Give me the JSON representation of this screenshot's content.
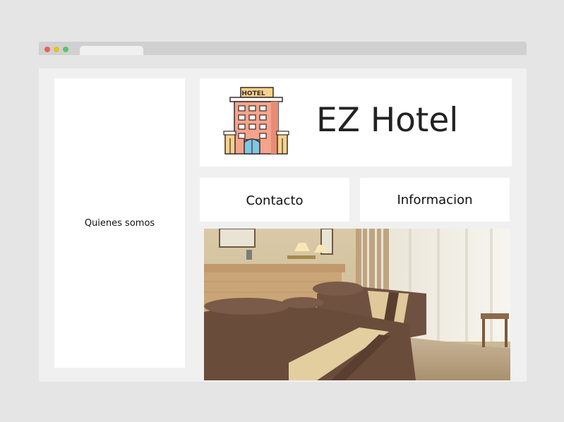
{
  "site": {
    "title": "EZ Hotel",
    "logo_sign": "HOTEL"
  },
  "sidebar": {
    "label": "Quienes somos"
  },
  "nav": {
    "items": [
      {
        "label": "Contacto"
      },
      {
        "label": "Informacion"
      }
    ]
  },
  "hero": {
    "subject": "hotel room with two beds",
    "alt": "Habitacion de hotel"
  },
  "colors": {
    "page_bg": "#e5e5e5",
    "viewport_bg": "#f0f0f0",
    "panel_bg": "#ffffff",
    "chrome_bar": "#d0d0d0",
    "building_pink": "#f4a48c",
    "building_yellow": "#f6d38a",
    "door_blue": "#7ec8e3"
  },
  "icons": {
    "logo": "hotel-building-icon",
    "window_controls": [
      "close-dot",
      "minimize-dot",
      "maximize-dot"
    ]
  }
}
